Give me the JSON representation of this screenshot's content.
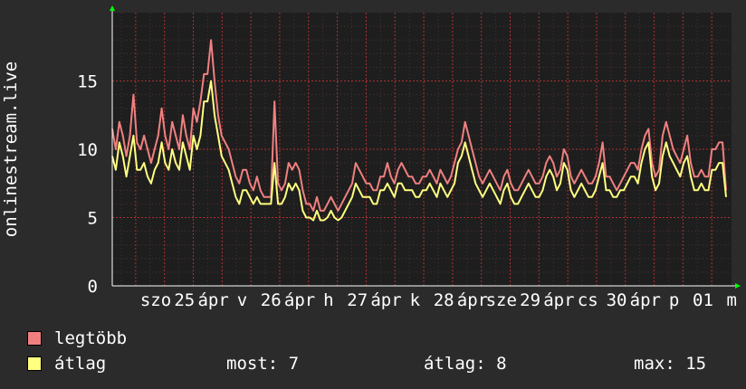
{
  "chart_data": {
    "type": "line",
    "ylabel": "onlinestream.live",
    "ylim": [
      0,
      20
    ],
    "yticks": [
      0,
      5,
      10,
      15
    ],
    "xticks": [
      "szo",
      "25",
      "ápr",
      "v",
      "26",
      "ápr",
      "h",
      "27",
      "ápr",
      "k",
      "28",
      "ápr",
      "sze",
      "29",
      "ápr",
      "cs",
      "30",
      "ápr",
      "p",
      "01",
      "m"
    ],
    "grid": true,
    "series": [
      {
        "name": "legtöbb",
        "color": "#f08080",
        "values": [
          11.5,
          10,
          12,
          11,
          9.5,
          11,
          14,
          10.5,
          10,
          11,
          10,
          9,
          10,
          11,
          13,
          11,
          10,
          12,
          11,
          10,
          12.5,
          11,
          10,
          13,
          12,
          13.5,
          15.5,
          15.5,
          18,
          15,
          12.5,
          11,
          10.5,
          10,
          9,
          8,
          7.5,
          8.5,
          8.5,
          7.5,
          7,
          8,
          7,
          6.5,
          6.5,
          6.5,
          13.5,
          7.5,
          7,
          7.5,
          9,
          8.5,
          9,
          8.5,
          7,
          6,
          6,
          5.5,
          6.5,
          5.5,
          5.5,
          6,
          6.5,
          6,
          5.5,
          6,
          6.5,
          7,
          7.5,
          9,
          8.5,
          8,
          7.5,
          7.5,
          7,
          7,
          8,
          8,
          9,
          8,
          7.5,
          8.5,
          9,
          8.5,
          8,
          8,
          7.5,
          7.5,
          8,
          8,
          8.5,
          8,
          7.5,
          8.5,
          8,
          7.5,
          8,
          9,
          10,
          10.5,
          12,
          11,
          10,
          9,
          8,
          7.5,
          8,
          8.5,
          8,
          7.5,
          7,
          8,
          8.5,
          7.5,
          7,
          7,
          7.5,
          8,
          8.5,
          8,
          7.5,
          7.5,
          8,
          9,
          9.5,
          9,
          8,
          8.5,
          10,
          9.5,
          8,
          7.5,
          8,
          8.5,
          8,
          7.5,
          7.5,
          8,
          9,
          10.5,
          8,
          8,
          7.5,
          7,
          7.5,
          8,
          8.5,
          9,
          9,
          8.5,
          10,
          11,
          11.5,
          9,
          8,
          8.5,
          11,
          12,
          11,
          10,
          9.5,
          9,
          10,
          11,
          9,
          8,
          8,
          8.5,
          8,
          8,
          10,
          10,
          10.5,
          10.5,
          7
        ]
      },
      {
        "name": "átlag",
        "color": "#ffff80",
        "values": [
          9.5,
          8.5,
          10.5,
          9.5,
          8,
          9.5,
          11,
          8.5,
          8.5,
          9,
          8,
          7.5,
          8.5,
          9,
          10.5,
          9,
          8.5,
          10,
          9,
          8.5,
          10.5,
          9.5,
          8.5,
          11,
          10,
          11,
          13.5,
          13.5,
          15,
          12.5,
          11,
          9.5,
          9,
          8.5,
          7.5,
          6.5,
          6,
          7,
          7,
          6.5,
          6,
          6.5,
          6,
          6,
          6,
          6,
          9,
          6,
          6,
          6.5,
          7.5,
          7,
          7.5,
          7,
          5.5,
          5,
          5,
          4.8,
          5.5,
          4.8,
          4.8,
          5,
          5.5,
          5,
          4.8,
          5,
          5.5,
          6,
          6.5,
          7.5,
          7,
          6.5,
          6.5,
          6.5,
          6,
          6,
          7,
          7,
          7.5,
          7,
          6.5,
          7.5,
          7.5,
          7,
          7,
          7,
          6.5,
          6.5,
          7,
          7,
          7.5,
          7,
          6.5,
          7.5,
          7,
          6.5,
          7,
          7.5,
          9,
          9.5,
          10.5,
          9.5,
          8.5,
          7.5,
          7,
          6.5,
          7,
          7.5,
          7,
          6.5,
          6,
          7,
          7.5,
          6.5,
          6,
          6,
          6.5,
          7,
          7.5,
          7,
          6.5,
          6.5,
          7,
          8,
          8.5,
          8,
          7,
          7.5,
          9,
          8.5,
          7,
          6.5,
          7,
          7.5,
          7,
          6.5,
          6.5,
          7,
          8,
          9,
          7,
          7,
          6.5,
          6.5,
          7,
          7,
          7.5,
          8,
          8,
          7.5,
          9,
          10,
          10.5,
          8,
          7,
          7.5,
          9.5,
          10.5,
          9.5,
          9,
          8.5,
          8,
          9,
          9.5,
          8,
          7,
          7,
          7.5,
          7,
          7,
          8.5,
          8.5,
          9,
          9,
          6.5
        ]
      }
    ]
  },
  "legend": [
    {
      "label": "legtöbb",
      "color": "#f08080"
    },
    {
      "label": "átlag",
      "color": "#ffff80"
    }
  ],
  "stats": {
    "most": "most: 7",
    "atlag": "átlag: 8",
    "max": "max: 15"
  }
}
